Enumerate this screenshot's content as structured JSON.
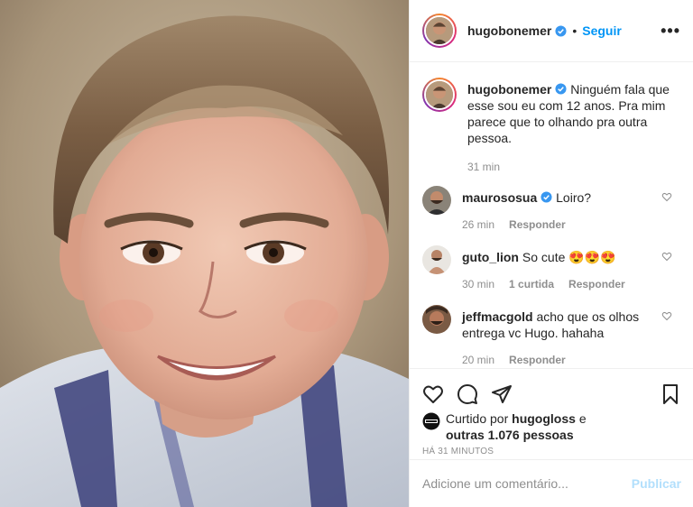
{
  "header": {
    "username": "hugobonemer",
    "follow_label": "Seguir",
    "more_label": "•••"
  },
  "caption": {
    "username": "hugobonemer",
    "text": "Ninguém fala que esse sou eu com 12 anos. Pra mim parece que to olhando pra outra pessoa.",
    "time": "31 min"
  },
  "comments": [
    {
      "username": "maurososua",
      "text": "Loiro?",
      "time": "26 min",
      "likes": "",
      "reply": "Responder"
    },
    {
      "username": "guto_lion",
      "text": "So cute 😍😍😍",
      "time": "30 min",
      "likes": "1 curtida",
      "reply": "Responder"
    },
    {
      "username": "jeffmacgold",
      "text": "acho que os olhos entrega vc Hugo. hahaha",
      "time": "20 min",
      "likes": "",
      "reply": "Responder"
    }
  ],
  "likes": {
    "prefix": "Curtido por",
    "user": "hugogloss",
    "connector": "e",
    "others": "outras 1.076 pessoas"
  },
  "post_time": "HÁ 31 MINUTOS",
  "comment_box": {
    "placeholder": "Adicione um comentário...",
    "publish_label": "Publicar"
  },
  "colors": {
    "accent": "#0095f6",
    "publish_disabled": "#b2dffc",
    "muted": "#8e8e8e"
  }
}
